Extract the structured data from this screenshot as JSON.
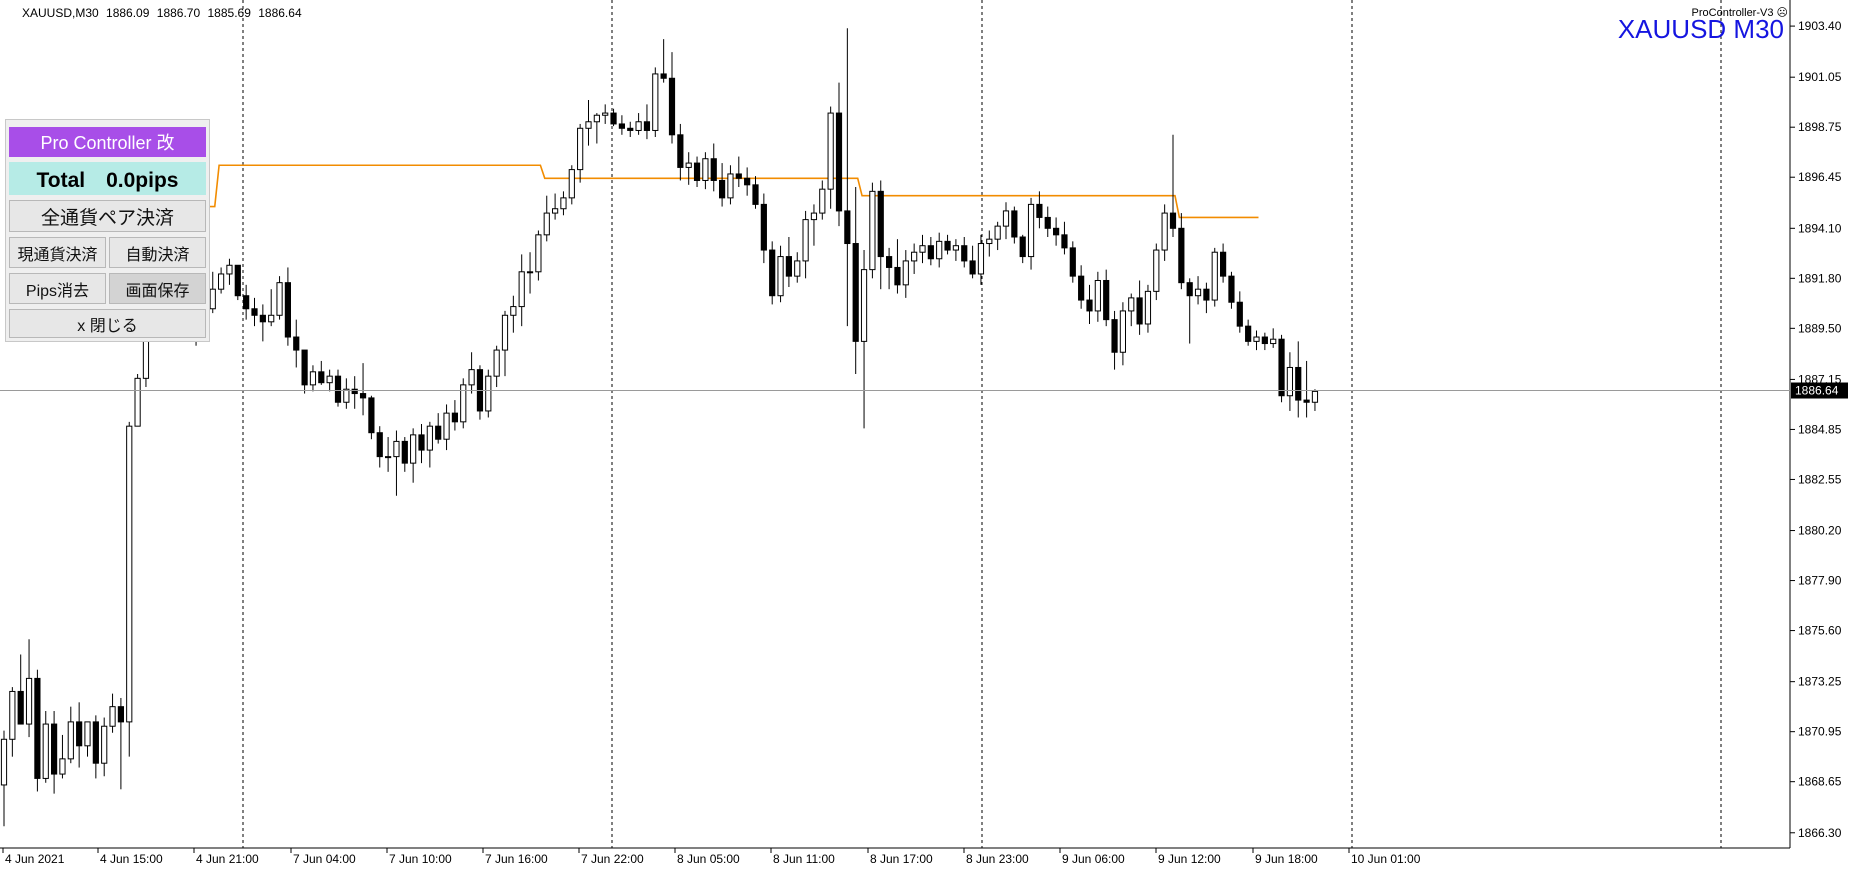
{
  "header": {
    "symbol": "XAUUSD,M30",
    "open": "1886.09",
    "high": "1886.70",
    "low": "1885.69",
    "close": "1886.64"
  },
  "indicator_label": "ProController-V3 ☹",
  "chart_title": "XAUUSD M30",
  "panel": {
    "title": "Pro Controller 改",
    "total": "Total　0.0pips",
    "close_all": "全通貨ペア決済",
    "close_current": "現通貨決済",
    "auto_close": "自動決済",
    "clear_pips": "Pips消去",
    "save_screen": "画面保存",
    "close_panel": "x 閉じる"
  },
  "colors": {
    "bull": "#000000",
    "bear": "#000000",
    "orange_line": "#f28c00",
    "price_line": "#9a9a9a",
    "title": "#1515e0",
    "panel_title": "#a84ee8",
    "panel_total": "#b6ebe6"
  },
  "chart_data": {
    "type": "candlestick",
    "symbol": "XAUUSD",
    "timeframe": "M30",
    "y_ticks": [
      "1903.40",
      "1901.05",
      "1898.75",
      "1896.45",
      "1894.10",
      "1891.80",
      "1889.50",
      "1887.15",
      "1884.85",
      "1882.55",
      "1880.20",
      "1877.90",
      "1875.60",
      "1873.25",
      "1870.95",
      "1868.65",
      "1866.30"
    ],
    "x_ticks": [
      "4 Jun 2021",
      "4 Jun 15:00",
      "4 Jun 21:00",
      "7 Jun 04:00",
      "7 Jun 10:00",
      "7 Jun 16:00",
      "7 Jun 22:00",
      "8 Jun 05:00",
      "8 Jun 11:00",
      "8 Jun 17:00",
      "8 Jun 23:00",
      "9 Jun 06:00",
      "9 Jun 12:00",
      "9 Jun 18:00",
      "10 Jun 01:00"
    ],
    "ylim": [
      1865.6,
      1904.6
    ],
    "current_price": "1886.64",
    "day_separators": [
      "4 Jun 21:00",
      "7 Jun 22:00",
      "8 Jun 23:00",
      "9 Jun 23:00"
    ],
    "orange_levels": [
      {
        "from_bar": 22,
        "to_bar": 25,
        "value": 1895.1
      },
      {
        "from_bar": 26,
        "to_bar": 64,
        "value": 1897.0
      },
      {
        "from_bar": 65,
        "to_bar": 102,
        "value": 1896.4
      },
      {
        "from_bar": 103,
        "to_bar": 140,
        "value": 1895.6
      },
      {
        "from_bar": 141,
        "to_bar": 150,
        "value": 1894.6
      }
    ],
    "candles": [
      [
        1868.5,
        1871.0,
        1866.6,
        1870.6
      ],
      [
        1870.6,
        1873.0,
        1869.8,
        1872.8
      ],
      [
        1872.8,
        1874.5,
        1871.5,
        1871.3
      ],
      [
        1871.3,
        1875.2,
        1870.7,
        1873.4
      ],
      [
        1873.4,
        1873.8,
        1868.2,
        1868.8
      ],
      [
        1868.8,
        1871.9,
        1868.6,
        1871.3
      ],
      [
        1871.3,
        1871.9,
        1868.1,
        1869.0
      ],
      [
        1869.0,
        1870.8,
        1868.8,
        1869.7
      ],
      [
        1869.7,
        1872.1,
        1869.5,
        1871.4
      ],
      [
        1871.4,
        1872.3,
        1869.3,
        1870.3
      ],
      [
        1870.3,
        1871.4,
        1869.8,
        1871.4
      ],
      [
        1871.4,
        1871.7,
        1868.8,
        1869.5
      ],
      [
        1869.5,
        1871.6,
        1868.9,
        1871.2
      ],
      [
        1871.2,
        1872.7,
        1870.9,
        1872.1
      ],
      [
        1872.1,
        1872.5,
        1868.3,
        1871.4
      ],
      [
        1871.4,
        1885.2,
        1869.8,
        1885.0
      ],
      [
        1885.0,
        1887.4,
        1886.2,
        1887.2
      ],
      [
        1887.2,
        1895.3,
        1886.8,
        1894.8
      ],
      [
        1894.8,
        1896.2,
        1892.0,
        1894.5
      ],
      [
        1894.5,
        1894.8,
        1893.8,
        1894.6
      ],
      [
        1894.6,
        1895.9,
        1891.5,
        1893.8
      ],
      [
        1893.8,
        1893.9,
        1889.9,
        1891.5
      ],
      [
        1891.5,
        1892.2,
        1889.2,
        1889.5
      ],
      [
        1889.5,
        1890.1,
        1888.7,
        1890.0
      ],
      [
        1890.0,
        1890.7,
        1889.4,
        1890.4
      ],
      [
        1890.4,
        1892.1,
        1890.2,
        1891.3
      ],
      [
        1891.3,
        1892.3,
        1891.1,
        1892.0
      ],
      [
        1892.0,
        1892.7,
        1891.5,
        1892.4
      ],
      [
        1892.4,
        1892.4,
        1890.8,
        1891.0
      ],
      [
        1891.0,
        1891.5,
        1889.9,
        1890.4
      ],
      [
        1890.4,
        1890.9,
        1889.6,
        1890.1
      ],
      [
        1890.1,
        1890.6,
        1888.9,
        1889.8
      ],
      [
        1889.8,
        1891.3,
        1889.6,
        1890.1
      ],
      [
        1890.1,
        1891.9,
        1889.9,
        1891.6
      ],
      [
        1891.6,
        1892.3,
        1888.7,
        1889.1
      ],
      [
        1889.1,
        1889.9,
        1887.7,
        1888.5
      ],
      [
        1888.5,
        1888.5,
        1886.5,
        1886.9
      ],
      [
        1886.9,
        1887.8,
        1886.6,
        1887.5
      ],
      [
        1887.5,
        1888.0,
        1886.9,
        1887.0
      ],
      [
        1887.0,
        1887.6,
        1886.6,
        1887.3
      ],
      [
        1887.3,
        1887.6,
        1885.9,
        1886.1
      ],
      [
        1886.1,
        1887.2,
        1885.8,
        1886.7
      ],
      [
        1886.7,
        1887.3,
        1885.8,
        1886.5
      ],
      [
        1886.5,
        1887.9,
        1885.5,
        1886.3
      ],
      [
        1886.3,
        1886.4,
        1884.4,
        1884.7
      ],
      [
        1884.7,
        1885.0,
        1883.1,
        1883.6
      ],
      [
        1883.6,
        1884.5,
        1882.9,
        1883.6
      ],
      [
        1883.6,
        1884.8,
        1881.8,
        1884.3
      ],
      [
        1884.3,
        1884.5,
        1882.9,
        1883.3
      ],
      [
        1883.3,
        1884.9,
        1882.4,
        1884.6
      ],
      [
        1884.6,
        1885.1,
        1883.3,
        1883.9
      ],
      [
        1883.9,
        1885.2,
        1883.1,
        1885.0
      ],
      [
        1885.0,
        1885.6,
        1884.2,
        1884.4
      ],
      [
        1884.4,
        1886.0,
        1883.9,
        1885.6
      ],
      [
        1885.6,
        1886.2,
        1884.8,
        1885.2
      ],
      [
        1885.2,
        1887.2,
        1884.9,
        1886.9
      ],
      [
        1886.9,
        1888.4,
        1886.5,
        1887.6
      ],
      [
        1887.6,
        1887.8,
        1885.3,
        1885.7
      ],
      [
        1885.7,
        1887.6,
        1885.4,
        1887.3
      ],
      [
        1887.3,
        1888.7,
        1886.8,
        1888.5
      ],
      [
        1888.5,
        1890.3,
        1887.3,
        1890.1
      ],
      [
        1890.1,
        1891.0,
        1889.3,
        1890.5
      ],
      [
        1890.5,
        1892.9,
        1889.6,
        1892.1
      ],
      [
        1892.1,
        1893.0,
        1891.1,
        1892.1
      ],
      [
        1892.1,
        1894.0,
        1891.7,
        1893.8
      ],
      [
        1893.8,
        1895.6,
        1893.5,
        1894.8
      ],
      [
        1894.8,
        1895.7,
        1894.5,
        1895.0
      ],
      [
        1895.0,
        1895.8,
        1894.7,
        1895.5
      ],
      [
        1895.5,
        1897.0,
        1895.2,
        1896.8
      ],
      [
        1896.8,
        1898.9,
        1896.2,
        1898.7
      ],
      [
        1898.7,
        1900.0,
        1897.9,
        1899.0
      ],
      [
        1899.0,
        1899.4,
        1898.0,
        1899.3
      ],
      [
        1899.3,
        1899.8,
        1898.9,
        1899.4
      ],
      [
        1899.4,
        1899.6,
        1898.8,
        1898.9
      ],
      [
        1898.9,
        1899.3,
        1898.4,
        1898.7
      ],
      [
        1898.7,
        1899.0,
        1898.3,
        1898.6
      ],
      [
        1898.6,
        1899.4,
        1898.4,
        1899.0
      ],
      [
        1899.0,
        1899.8,
        1898.2,
        1898.6
      ],
      [
        1898.6,
        1901.5,
        1898.3,
        1901.2
      ],
      [
        1901.2,
        1902.8,
        1900.8,
        1901.0
      ],
      [
        1901.0,
        1902.2,
        1898.0,
        1898.4
      ],
      [
        1898.4,
        1898.9,
        1896.3,
        1896.9
      ],
      [
        1896.9,
        1897.6,
        1896.1,
        1897.1
      ],
      [
        1897.1,
        1897.4,
        1896.0,
        1896.3
      ],
      [
        1896.3,
        1897.6,
        1895.9,
        1897.3
      ],
      [
        1897.3,
        1898.0,
        1895.8,
        1896.3
      ],
      [
        1896.3,
        1897.1,
        1895.1,
        1895.5
      ],
      [
        1895.5,
        1897.0,
        1895.2,
        1896.6
      ],
      [
        1896.6,
        1897.4,
        1896.0,
        1896.4
      ],
      [
        1896.4,
        1896.9,
        1895.6,
        1896.1
      ],
      [
        1896.1,
        1896.5,
        1895.0,
        1895.2
      ],
      [
        1895.2,
        1895.7,
        1892.5,
        1893.1
      ],
      [
        1893.1,
        1893.5,
        1890.6,
        1891.0
      ],
      [
        1891.0,
        1893.3,
        1890.7,
        1892.8
      ],
      [
        1892.8,
        1893.7,
        1891.4,
        1891.9
      ],
      [
        1891.9,
        1893.0,
        1891.6,
        1892.6
      ],
      [
        1892.6,
        1894.9,
        1891.8,
        1894.5
      ],
      [
        1894.5,
        1895.2,
        1893.3,
        1894.8
      ],
      [
        1894.8,
        1896.3,
        1894.5,
        1895.9
      ],
      [
        1895.9,
        1899.7,
        1895.0,
        1899.4
      ],
      [
        1899.4,
        1900.8,
        1894.2,
        1894.9
      ],
      [
        1894.9,
        1903.3,
        1889.6,
        1893.4
      ],
      [
        1893.4,
        1896.0,
        1887.4,
        1888.9
      ],
      [
        1888.9,
        1893.1,
        1884.9,
        1892.2
      ],
      [
        1892.2,
        1896.2,
        1891.8,
        1895.8
      ],
      [
        1895.8,
        1896.3,
        1891.3,
        1892.8
      ],
      [
        1892.8,
        1893.2,
        1891.3,
        1892.3
      ],
      [
        1892.3,
        1893.6,
        1891.1,
        1891.5
      ],
      [
        1891.5,
        1893.1,
        1890.9,
        1892.6
      ],
      [
        1892.6,
        1893.4,
        1892.0,
        1893.0
      ],
      [
        1893.0,
        1893.8,
        1892.5,
        1893.3
      ],
      [
        1893.3,
        1893.7,
        1892.4,
        1892.7
      ],
      [
        1892.7,
        1893.9,
        1892.3,
        1893.5
      ],
      [
        1893.5,
        1893.8,
        1892.9,
        1893.1
      ],
      [
        1893.1,
        1893.6,
        1892.6,
        1893.3
      ],
      [
        1893.3,
        1893.7,
        1892.3,
        1892.6
      ],
      [
        1892.6,
        1893.3,
        1891.8,
        1892.0
      ],
      [
        1892.0,
        1893.8,
        1891.5,
        1893.4
      ],
      [
        1893.4,
        1894.0,
        1892.8,
        1893.6
      ],
      [
        1893.6,
        1894.4,
        1893.1,
        1894.2
      ],
      [
        1894.2,
        1895.3,
        1893.6,
        1894.9
      ],
      [
        1894.9,
        1895.1,
        1893.4,
        1893.7
      ],
      [
        1893.7,
        1893.8,
        1892.5,
        1892.8
      ],
      [
        1892.8,
        1895.5,
        1892.2,
        1895.2
      ],
      [
        1895.2,
        1895.8,
        1894.1,
        1894.6
      ],
      [
        1894.6,
        1895.1,
        1893.7,
        1894.1
      ],
      [
        1894.1,
        1894.6,
        1893.3,
        1893.8
      ],
      [
        1893.8,
        1894.4,
        1892.9,
        1893.2
      ],
      [
        1893.2,
        1893.5,
        1891.6,
        1891.9
      ],
      [
        1891.9,
        1892.4,
        1890.4,
        1890.8
      ],
      [
        1890.8,
        1891.5,
        1889.7,
        1890.3
      ],
      [
        1890.3,
        1892.1,
        1889.8,
        1891.7
      ],
      [
        1891.7,
        1892.2,
        1889.6,
        1889.9
      ],
      [
        1889.9,
        1890.3,
        1887.6,
        1888.4
      ],
      [
        1888.4,
        1890.7,
        1887.8,
        1890.3
      ],
      [
        1890.3,
        1891.1,
        1889.6,
        1890.9
      ],
      [
        1890.9,
        1891.7,
        1889.2,
        1889.7
      ],
      [
        1889.7,
        1891.5,
        1889.3,
        1891.2
      ],
      [
        1891.2,
        1893.4,
        1890.8,
        1893.1
      ],
      [
        1893.1,
        1895.2,
        1892.6,
        1894.8
      ],
      [
        1894.8,
        1898.4,
        1893.7,
        1894.1
      ],
      [
        1894.1,
        1894.8,
        1891.3,
        1891.6
      ],
      [
        1891.6,
        1891.8,
        1888.8,
        1891.0
      ],
      [
        1891.0,
        1891.9,
        1890.6,
        1891.3
      ],
      [
        1891.3,
        1891.6,
        1890.2,
        1890.8
      ],
      [
        1890.8,
        1893.2,
        1890.5,
        1893.0
      ],
      [
        1893.0,
        1893.4,
        1891.6,
        1891.9
      ],
      [
        1891.9,
        1892.1,
        1890.4,
        1890.7
      ],
      [
        1890.7,
        1891.2,
        1889.3,
        1889.6
      ],
      [
        1889.6,
        1889.9,
        1888.7,
        1888.9
      ],
      [
        1888.9,
        1889.4,
        1888.5,
        1889.1
      ],
      [
        1889.1,
        1889.3,
        1888.5,
        1888.8
      ],
      [
        1888.8,
        1889.5,
        1888.6,
        1889.0
      ],
      [
        1889.0,
        1889.2,
        1886.1,
        1886.4
      ],
      [
        1886.4,
        1888.4,
        1885.7,
        1887.7
      ],
      [
        1887.7,
        1888.9,
        1885.4,
        1886.2
      ],
      [
        1886.2,
        1888.0,
        1885.4,
        1886.1
      ],
      [
        1886.1,
        1886.7,
        1885.7,
        1886.6
      ]
    ]
  }
}
